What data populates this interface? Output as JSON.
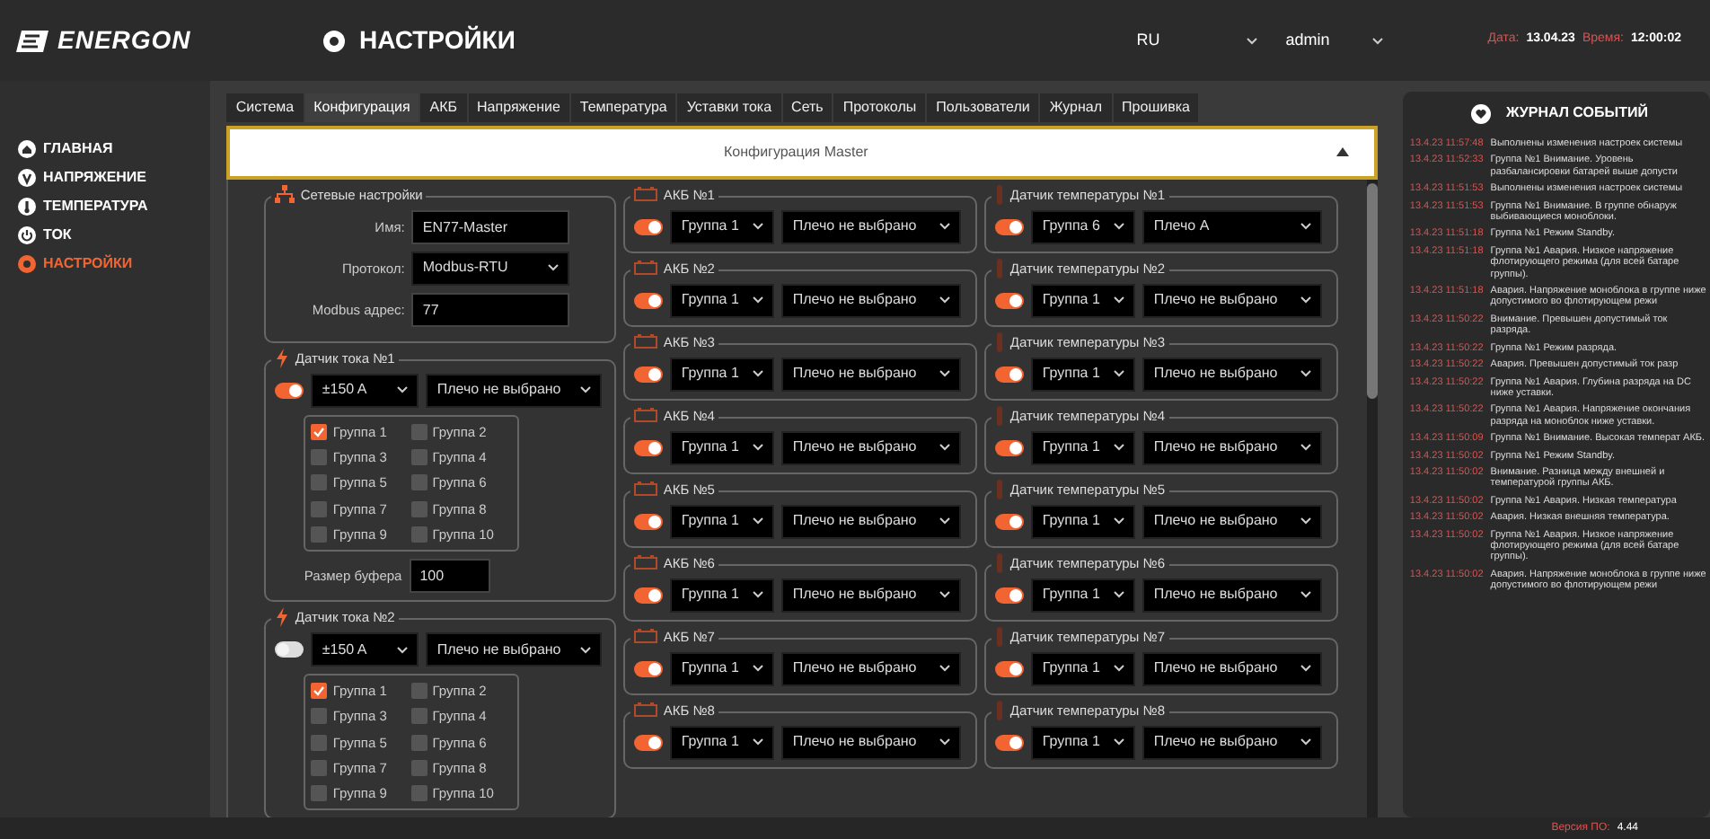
{
  "header": {
    "logo": "ENERGON",
    "page_title": "НАСТРОЙКИ",
    "language": "RU",
    "user": "admin",
    "date_label": "Дата:",
    "date": "13.04.23",
    "time_label": "Время:",
    "time": "12:00:02"
  },
  "sidebar": {
    "items": [
      {
        "label": "ГЛАВНАЯ",
        "kind": "home",
        "selected": false
      },
      {
        "label": "НАПРЯЖЕНИЕ",
        "kind": "voltage",
        "selected": false
      },
      {
        "label": "ТЕМПЕРАТУРА",
        "kind": "temperature",
        "selected": false
      },
      {
        "label": "ТОК",
        "kind": "current",
        "selected": false
      },
      {
        "label": "НАСТРОЙКИ",
        "kind": "settings",
        "selected": true
      }
    ]
  },
  "tabs": [
    {
      "label": "Система",
      "selected": false
    },
    {
      "label": "Конфигурация",
      "selected": true
    },
    {
      "label": "АКБ",
      "selected": false
    },
    {
      "label": "Напряжение",
      "selected": false
    },
    {
      "label": "Температура",
      "selected": false
    },
    {
      "label": "Уставки тока",
      "selected": false
    },
    {
      "label": "Сеть",
      "selected": false
    },
    {
      "label": "Протоколы",
      "selected": false
    },
    {
      "label": "Пользователи",
      "selected": false
    },
    {
      "label": "Журнал",
      "selected": false
    },
    {
      "label": "Прошивка",
      "selected": false
    }
  ],
  "accordion": {
    "title": "Конфигурация Master",
    "expanded": true
  },
  "network": {
    "title": "Сетевые настройки",
    "fields": [
      {
        "label": "Имя:",
        "value": "EN77-Master",
        "kind": "input"
      },
      {
        "label": "Протокол:",
        "value": "Modbus-RTU",
        "kind": "select"
      },
      {
        "label": "Modbus адрес:",
        "value": "77",
        "kind": "input"
      }
    ]
  },
  "current_sensors": [
    {
      "title": "Датчик тока №1",
      "enabled": true,
      "range": "±150 A",
      "arm": "Плечо не выбрано",
      "groups": [
        {
          "label": "Группа 1",
          "checked": true
        },
        {
          "label": "Группа 2",
          "checked": false
        },
        {
          "label": "Группа 3",
          "checked": false
        },
        {
          "label": "Группа 4",
          "checked": false
        },
        {
          "label": "Группа 5",
          "checked": false
        },
        {
          "label": "Группа 6",
          "checked": false
        },
        {
          "label": "Группа 7",
          "checked": false
        },
        {
          "label": "Группа 8",
          "checked": false
        },
        {
          "label": "Группа 9",
          "checked": false
        },
        {
          "label": "Группа 10",
          "checked": false
        }
      ],
      "buffer_label": "Размер буфера",
      "buffer_value": "100"
    },
    {
      "title": "Датчик тока №2",
      "enabled": false,
      "range": "±150 A",
      "arm": "Плечо не выбрано",
      "groups": [
        {
          "label": "Группа 1",
          "checked": true
        },
        {
          "label": "Группа 2",
          "checked": false
        },
        {
          "label": "Группа 3",
          "checked": false
        },
        {
          "label": "Группа 4",
          "checked": false
        },
        {
          "label": "Группа 5",
          "checked": false
        },
        {
          "label": "Группа 6",
          "checked": false
        },
        {
          "label": "Группа 7",
          "checked": false
        },
        {
          "label": "Группа 8",
          "checked": false
        },
        {
          "label": "Группа 9",
          "checked": false
        },
        {
          "label": "Группа 10",
          "checked": false
        }
      ]
    }
  ],
  "batteries": [
    {
      "title": "АКБ №1",
      "enabled": true,
      "group": "Группа 1",
      "arm": "Плечо не выбрано"
    },
    {
      "title": "АКБ №2",
      "enabled": true,
      "group": "Группа 1",
      "arm": "Плечо не выбрано"
    },
    {
      "title": "АКБ №3",
      "enabled": true,
      "group": "Группа 1",
      "arm": "Плечо не выбрано"
    },
    {
      "title": "АКБ №4",
      "enabled": true,
      "group": "Группа 1",
      "arm": "Плечо не выбрано"
    },
    {
      "title": "АКБ №5",
      "enabled": true,
      "group": "Группа 1",
      "arm": "Плечо не выбрано"
    },
    {
      "title": "АКБ №6",
      "enabled": true,
      "group": "Группа 1",
      "arm": "Плечо не выбрано"
    },
    {
      "title": "АКБ №7",
      "enabled": true,
      "group": "Группа 1",
      "arm": "Плечо не выбрано"
    },
    {
      "title": "АКБ №8",
      "enabled": true,
      "group": "Группа 1",
      "arm": "Плечо не выбрано"
    }
  ],
  "temperature_sensors": [
    {
      "title": "Датчик температуры №1",
      "enabled": true,
      "group": "Группа 6",
      "arm": "Плечо A"
    },
    {
      "title": "Датчик температуры №2",
      "enabled": true,
      "group": "Группа 1",
      "arm": "Плечо не выбрано"
    },
    {
      "title": "Датчик температуры №3",
      "enabled": true,
      "group": "Группа 1",
      "arm": "Плечо не выбрано"
    },
    {
      "title": "Датчик температуры №4",
      "enabled": true,
      "group": "Группа 1",
      "arm": "Плечо не выбрано"
    },
    {
      "title": "Датчик температуры №5",
      "enabled": true,
      "group": "Группа 1",
      "arm": "Плечо не выбрано"
    },
    {
      "title": "Датчик температуры №6",
      "enabled": true,
      "group": "Группа 1",
      "arm": "Плечо не выбрано"
    },
    {
      "title": "Датчик температуры №7",
      "enabled": true,
      "group": "Группа 1",
      "arm": "Плечо не выбрано"
    },
    {
      "title": "Датчик температуры №8",
      "enabled": true,
      "group": "Группа 1",
      "arm": "Плечо не выбрано"
    }
  ],
  "journal": {
    "title": "ЖУРНАЛ СОБЫТИЙ",
    "entries": [
      {
        "time": "13.4.23 11:57:48",
        "text": "Выполнены изменения настроек системы"
      },
      {
        "time": "13.4.23 11:52:33",
        "text": "Группа №1 Внимание. Уровень разбалансировки батарей выше допусти"
      },
      {
        "time": "13.4.23 11:51:53",
        "text": "Выполнены изменения настроек системы"
      },
      {
        "time": "13.4.23 11:51:53",
        "text": "Группа №1 Внимание. В группе обнаруж выбивающиеся моноблоки."
      },
      {
        "time": "13.4.23 11:51:18",
        "text": "Группа №1 Режим Standby."
      },
      {
        "time": "13.4.23 11:51:18",
        "text": "Группа №1 Авария. Низкое напряжение флотирующего режима (для всей батаре группы)."
      },
      {
        "time": "13.4.23 11:51:18",
        "text": "Авария. Напряжение моноблока в группе ниже допустимого во флотирующем режи"
      },
      {
        "time": "13.4.23 11:50:22",
        "text": "Внимание. Превышен допустимый ток разряда."
      },
      {
        "time": "13.4.23 11:50:22",
        "text": "Группа №1 Режим разряда."
      },
      {
        "time": "13.4.23 11:50:22",
        "text": "Авария. Превышен допустимый ток разр"
      },
      {
        "time": "13.4.23 11:50:22",
        "text": "Группа №1 Авария. Глубина разряда на DC ниже уставки."
      },
      {
        "time": "13.4.23 11:50:22",
        "text": "Группа №1 Авария. Напряжение окончания разряда на моноблок ниже уставки."
      },
      {
        "time": "13.4.23 11:50:09",
        "text": "Группа №1 Внимание. Высокая температ АКБ."
      },
      {
        "time": "13.4.23 11:50:02",
        "text": "Группа №1 Режим Standby."
      },
      {
        "time": "13.4.23 11:50:02",
        "text": "Внимание. Разница между внешней и температурой группы АКБ."
      },
      {
        "time": "13.4.23 11:50:02",
        "text": "Группа №1 Авария. Низкая температура"
      },
      {
        "time": "13.4.23 11:50:02",
        "text": "Авария. Низкая внешняя температура."
      },
      {
        "time": "13.4.23 11:50:02",
        "text": "Группа №1 Авария. Низкое напряжение флотирующего режима (для всей батаре группы)."
      },
      {
        "time": "13.4.23 11:50:02",
        "text": "Авария. Напряжение моноблока в группе ниже допустимого во флотирующем режи"
      }
    ]
  },
  "footer": {
    "version_label": "Версия ПО:",
    "version": "4.44"
  }
}
